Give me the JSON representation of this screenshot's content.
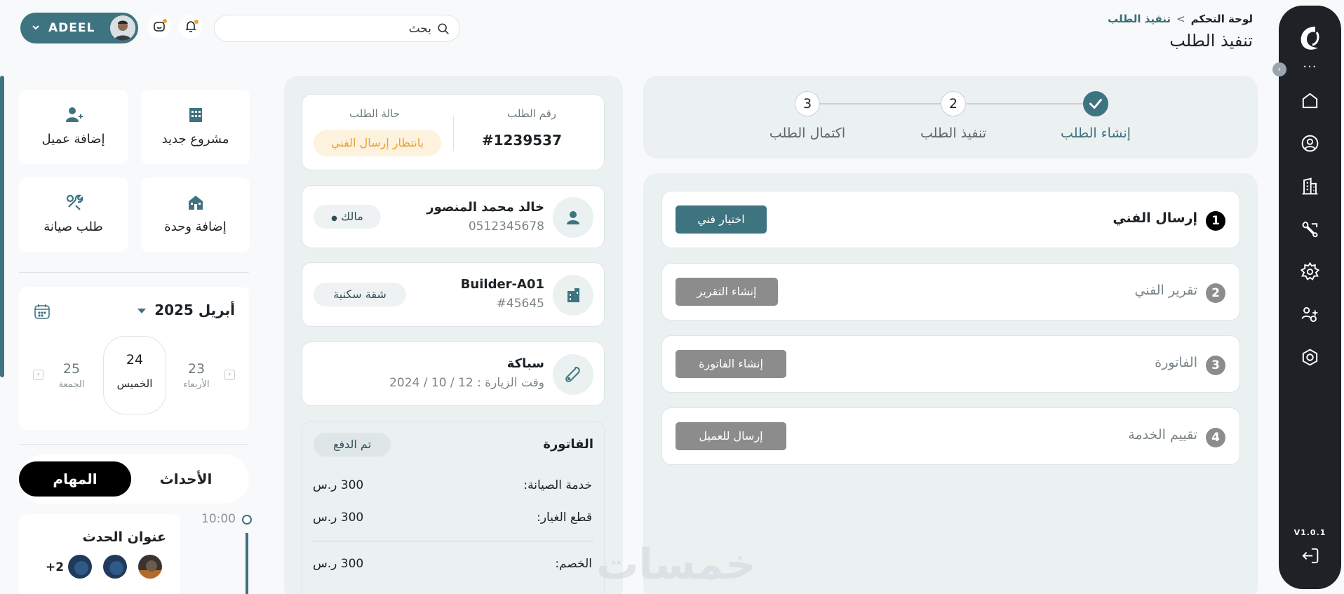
{
  "breadcrumb": {
    "home": "لوحة التحكم",
    "separator": ">",
    "current": "تنفيذ الطلب"
  },
  "page_title": "تنفيذ الطلب",
  "search": {
    "placeholder": "بحث",
    "value": ""
  },
  "user": {
    "name": "ADEEL"
  },
  "sidebar": {
    "version": "V1.0.1",
    "items": [
      {
        "icon": "home-icon"
      },
      {
        "icon": "user-circle-icon"
      },
      {
        "icon": "building-icon"
      },
      {
        "icon": "services-icon"
      },
      {
        "icon": "settings-icon"
      },
      {
        "icon": "users-icon"
      },
      {
        "icon": "target-icon"
      }
    ],
    "logout_icon": "logout-icon"
  },
  "steps": [
    {
      "number": "1",
      "label": "إنشاء الطلب",
      "state": "done"
    },
    {
      "number": "2",
      "label": "تنفيذ الطلب",
      "state": "pending"
    },
    {
      "number": "3",
      "label": "اكتمال الطلب",
      "state": "pending"
    }
  ],
  "actions": [
    {
      "number": "1",
      "label": "إرسال الفني",
      "button": "اختيار فني",
      "enabled": true
    },
    {
      "number": "2",
      "label": "تقرير الفني",
      "button": "إنشاء التقرير",
      "enabled": false
    },
    {
      "number": "3",
      "label": "الفاتورة",
      "button": "إنشاء الفاتورة",
      "enabled": false
    },
    {
      "number": "4",
      "label": "تقييم الخدمة",
      "button": "إرسال للعميل",
      "enabled": false
    }
  ],
  "order": {
    "number_label": "رقم الطلب",
    "number": "#1239537",
    "status_label": "حالة الطلب",
    "status": "بانتظار إرسال الفني"
  },
  "customer": {
    "name": "خالد محمد المنصور",
    "phone": "0512345678",
    "role": "مالك"
  },
  "unit": {
    "name": "Builder-A01",
    "code": "#45645",
    "type": "شقة سكنية"
  },
  "service": {
    "name": "سباكة",
    "visit": "وقت الزيارة : 12 / 10 / 2024"
  },
  "invoice": {
    "title": "الفاتورة",
    "status": "تم الدفع",
    "rows": [
      {
        "label": "خدمة الصيانة:",
        "value": "300 ر.س"
      },
      {
        "label": "قطع الغيار:",
        "value": "300 ر.س"
      },
      {
        "label": "الخصم:",
        "value": "300 ر.س"
      }
    ]
  },
  "quick_actions": [
    {
      "label": "مشروع جديد",
      "icon": "building-icon"
    },
    {
      "label": "إضافة عميل",
      "icon": "add-user-icon"
    },
    {
      "label": "إضافة وحدة",
      "icon": "home-building-icon"
    },
    {
      "label": "طلب صيانة",
      "icon": "tools-icon"
    }
  ],
  "calendar": {
    "month": "أبريل 2025",
    "days": [
      {
        "num": "23",
        "name": "الأربعاء"
      },
      {
        "num": "24",
        "name": "الخميس",
        "selected": true
      },
      {
        "num": "25",
        "name": "الجمعة"
      }
    ]
  },
  "tabs": {
    "events": "الأحداث",
    "tasks": "المهام"
  },
  "event": {
    "time": "10:00",
    "title": "عنوان الحدث",
    "more": "+2"
  },
  "colors": {
    "accent": "#3e7380",
    "rail": "#1e2226",
    "warning": "#e5a23c",
    "disabled": "#8c8c8c"
  }
}
